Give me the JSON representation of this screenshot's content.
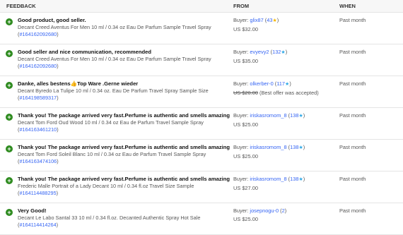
{
  "header": {
    "feedback": "FEEDBACK",
    "from": "FROM",
    "when": "WHEN"
  },
  "rows": [
    {
      "comment": "Good product, good seller.",
      "item": "Decant Creed Aventus For Men 10 ml / 0.34 oz Eau De Parfum Sample Travel Spray",
      "item_id": "#164162092680",
      "buyer_prefix": "Buyer: ",
      "buyer": "glix87",
      "score": "43",
      "star_color": "#f5b600",
      "price": "US $32.00",
      "price_note": "",
      "when": "Past month"
    },
    {
      "comment": "Good seller and nice communication, recommended",
      "item": "Decant Creed Aventus For Men 10 ml / 0.34 oz Eau De Parfum Sample Travel Spray",
      "item_id": "#164162092680",
      "buyer_prefix": "Buyer: ",
      "buyer": "evyevy2",
      "score": "132",
      "star_color": "#2ea8e6",
      "price": "US $35.00",
      "price_note": "",
      "when": "Past month"
    },
    {
      "comment": "Danke, alles bestens👍Top Ware .Gerne wieder",
      "item": "Decant Byredo La Tulipe 10 ml / 0.34 oz. Eau De Parfum Travel Spray Sample Size",
      "item_id": "#164198589317",
      "buyer_prefix": "Buyer: ",
      "buyer": "olkerber-0",
      "score": "117",
      "star_color": "#2ea8e6",
      "price": "US $20.00",
      "price_note": " (Best offer was accepted)",
      "when": "Past month"
    },
    {
      "comment": "Thank you! The package arrived very fast.Perfume is authentic and smells amazing",
      "item": "Decant Tom Ford Oud Wood 10 ml / 0.34 oz Eau de Parfum Travel Sample Spray",
      "item_id": "#164163461210",
      "buyer_prefix": "Buyer: ",
      "buyer": "iriskasromom_8",
      "score": "138",
      "star_color": "#2ea8e6",
      "price": "US $25.00",
      "price_note": "",
      "when": "Past month"
    },
    {
      "comment": "Thank you! The package arrived very fast.Perfume is authentic and smells amazing",
      "item": "Decant Tom Ford Soleil Blanc 10 ml / 0.34 oz Eau de Parfum Travel Sample Spray",
      "item_id": "#164163474106",
      "buyer_prefix": "Buyer: ",
      "buyer": "iriskasromom_8",
      "score": "138",
      "star_color": "#2ea8e6",
      "price": "US $25.00",
      "price_note": "",
      "when": "Past month"
    },
    {
      "comment": "Thank you! The package arrived very fast.Perfume is authentic and smells amazing",
      "item": "Frederic Malle Portrait of a Lady Decant 10 ml / 0.34 fl.oz Travel Size Sample",
      "item_id": "#164114488295",
      "buyer_prefix": "Buyer: ",
      "buyer": "iriskasromom_8",
      "score": "138",
      "star_color": "#2ea8e6",
      "price": "US $27.00",
      "price_note": "",
      "when": "Past month"
    },
    {
      "comment": "Very Good!",
      "item": "Decant Le Labo Santal 33 10 ml / 0.34 fl.oz. Decanted Authentic Spray Hot Sale",
      "item_id": "#164114414264",
      "buyer_prefix": "Buyer: ",
      "buyer": "josepnogu-0",
      "score": "2",
      "star_color": "",
      "price": "US $25.00",
      "price_note": "",
      "when": "Past month"
    }
  ]
}
